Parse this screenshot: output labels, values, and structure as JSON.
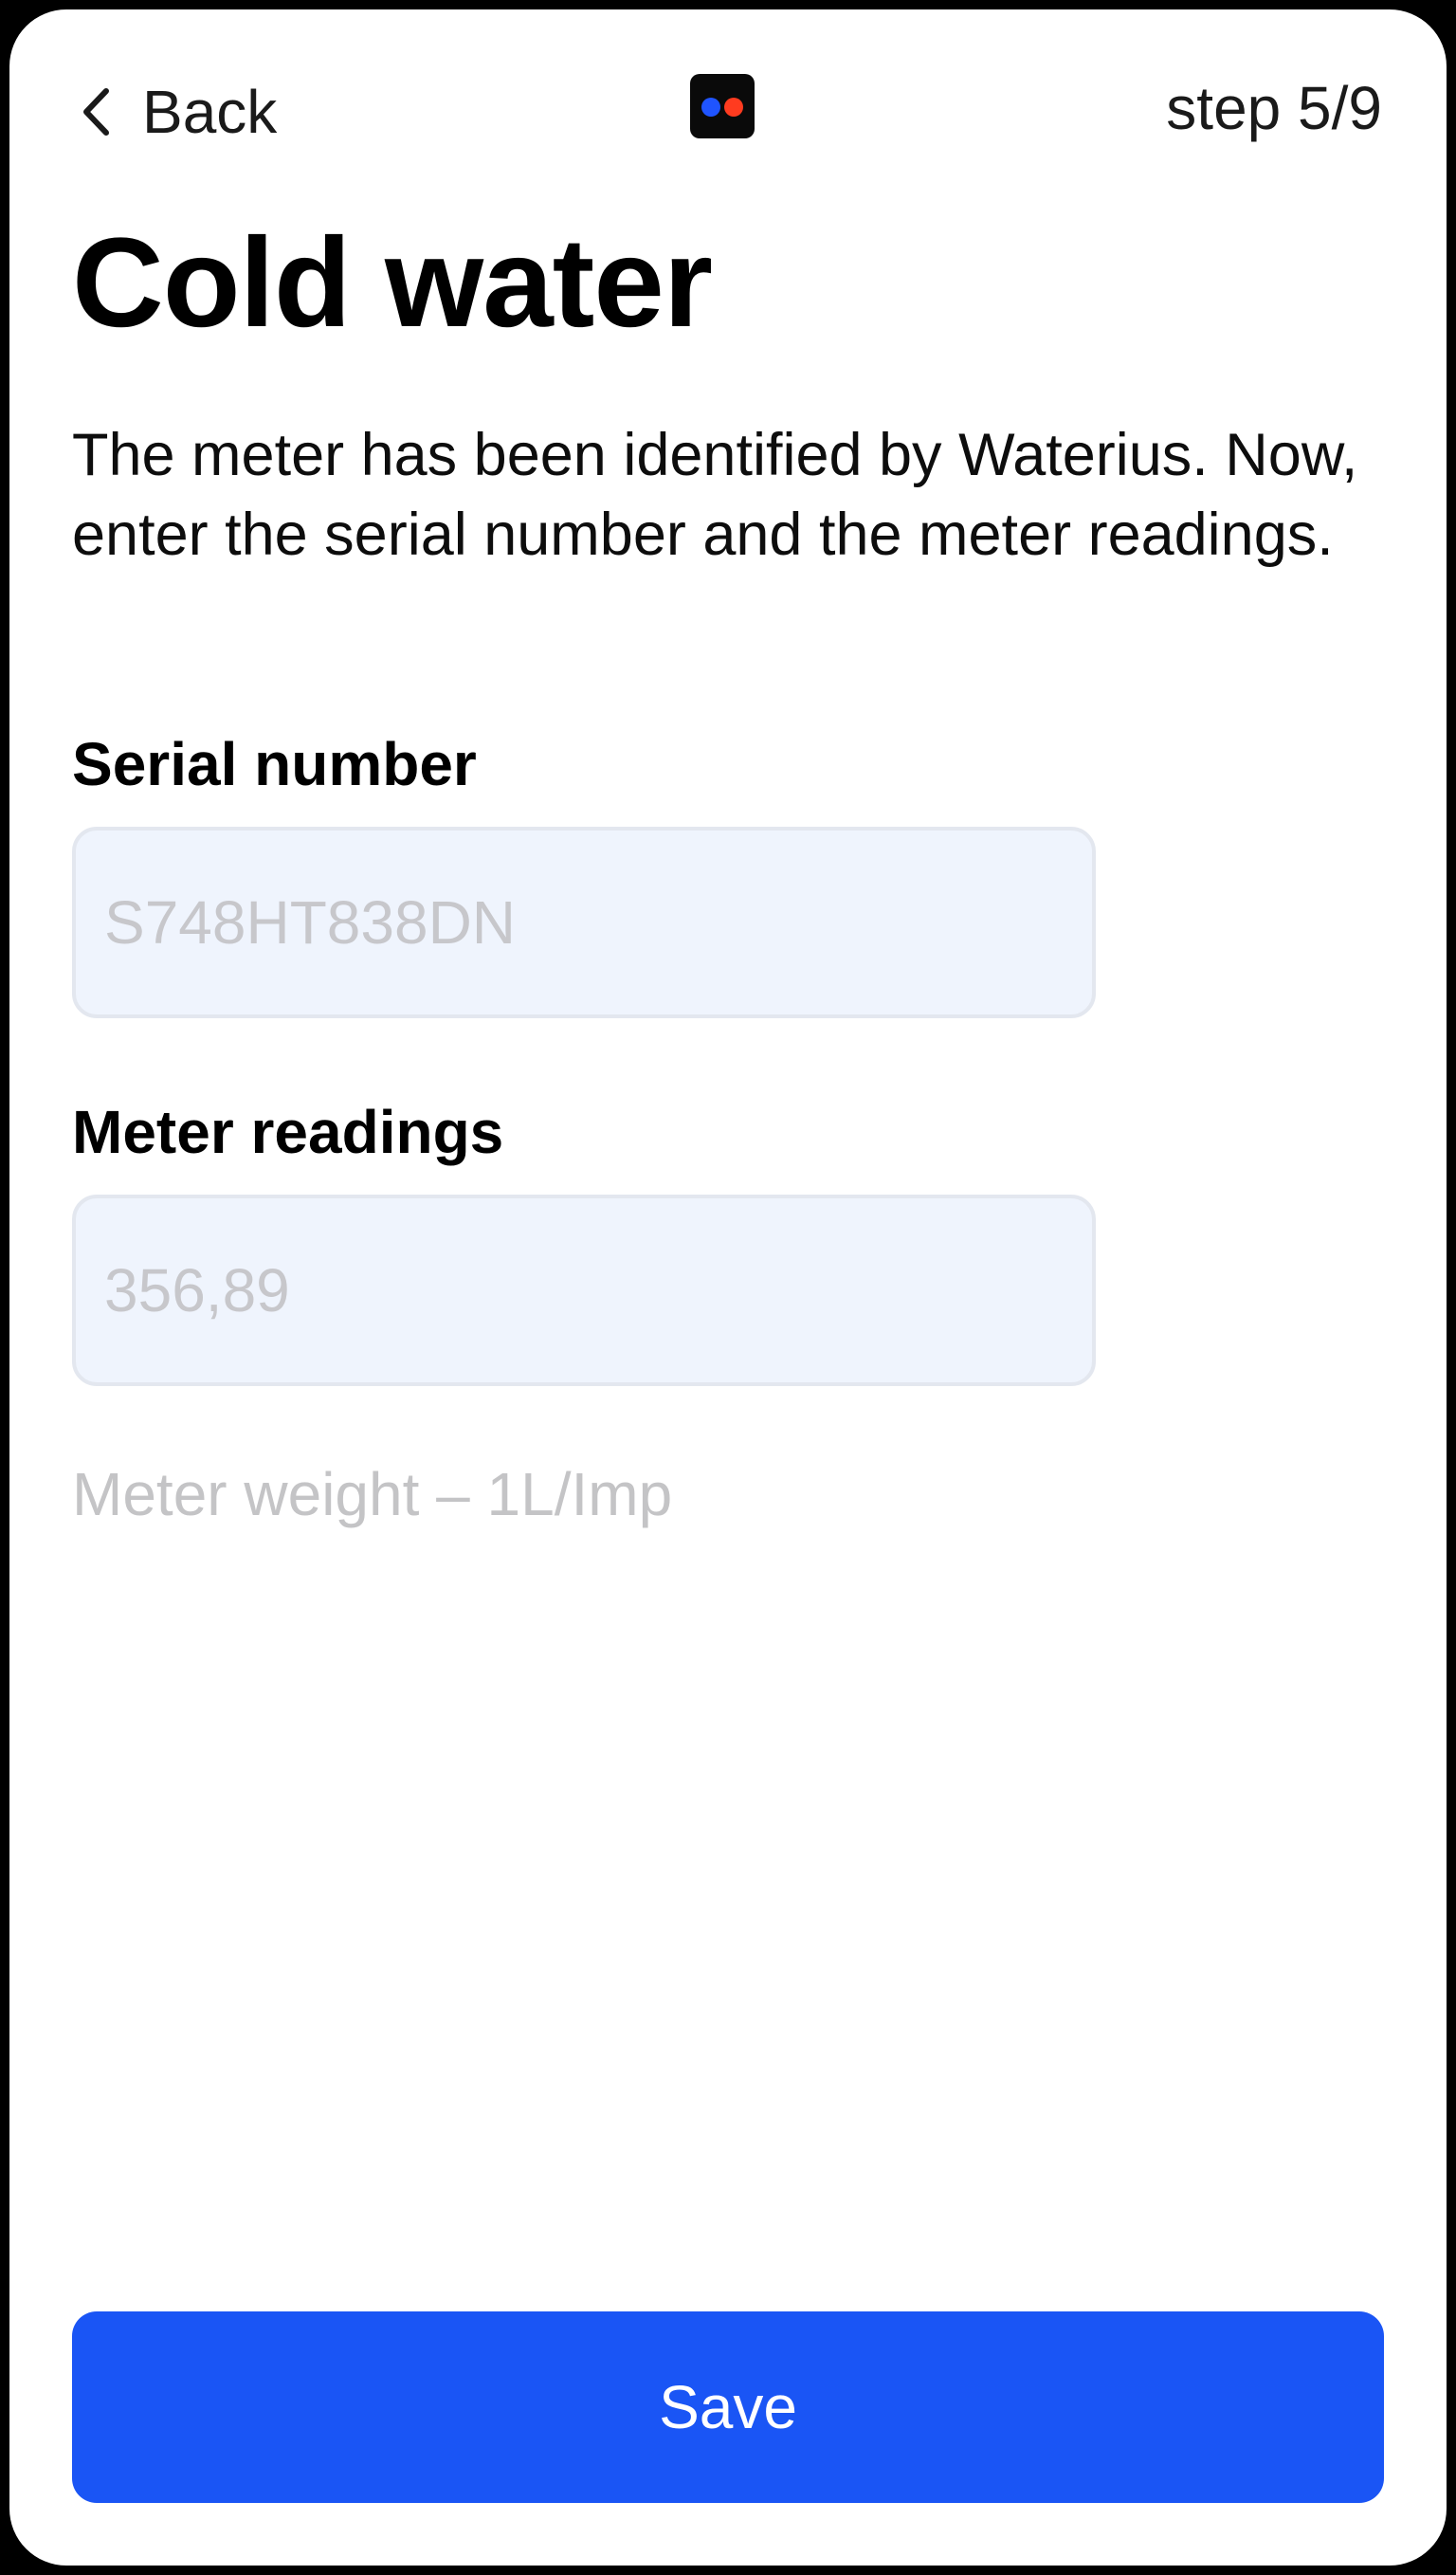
{
  "header": {
    "back_label": "Back",
    "back_icon": "chevron-left-icon",
    "logo_icon": "waterius-logo-icon",
    "step": "step 5/9"
  },
  "main": {
    "title": "Cold water",
    "description": "The meter has been identified by Waterius. Now, enter the serial number and the meter readings.",
    "serial": {
      "label": "Serial number",
      "value": "",
      "placeholder": "S748HT838DN"
    },
    "readings": {
      "label": "Meter readings",
      "value": "",
      "placeholder": "356,89"
    },
    "hint": "Meter weight – 1L/Imp"
  },
  "footer": {
    "save_label": "Save"
  },
  "colors": {
    "accent": "#1a55f5",
    "input_background": "#eff4fd",
    "placeholder": "#c7c7cb",
    "logo_dot_blue": "#1f54ff",
    "logo_dot_red": "#ff3b1f"
  }
}
